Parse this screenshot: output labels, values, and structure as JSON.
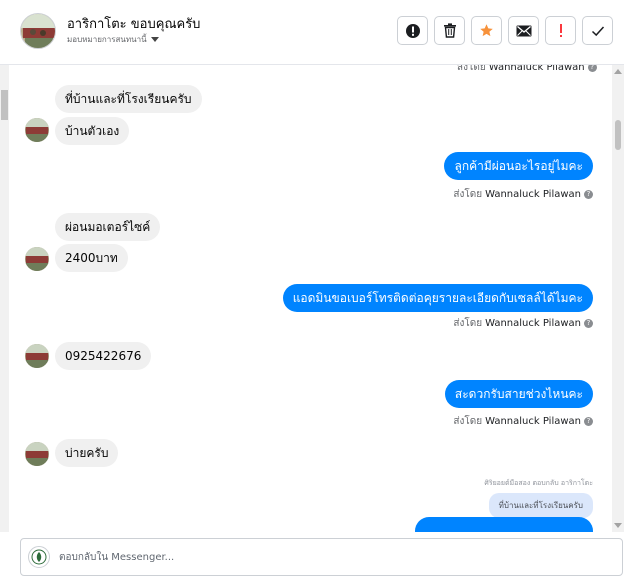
{
  "header": {
    "title": "อาริกาโตะ ขอบคุณครับ",
    "subtitle": "มอบหมายการสนทนานี้",
    "actions": [
      {
        "name": "alert-circle",
        "icon": "alert-circle-icon",
        "color": "#1c1e21"
      },
      {
        "name": "delete",
        "icon": "trash-icon",
        "color": "#1c1e21"
      },
      {
        "name": "star",
        "icon": "star-icon",
        "color": "#f7923b"
      },
      {
        "name": "mail",
        "icon": "envelope-icon",
        "color": "#1c1e21"
      },
      {
        "name": "spam",
        "icon": "exclamation-icon",
        "color": "#fa383e"
      },
      {
        "name": "done",
        "icon": "checkmark-icon",
        "color": "#1c1e21"
      }
    ]
  },
  "chat": {
    "top_sent_by": {
      "prefix": "ส่งโดย",
      "name": "Wannaluck Pilawan"
    },
    "messages": [
      {
        "dir": "in",
        "text": "ที่บ้านและที่โรงเรียนครับ"
      },
      {
        "dir": "in",
        "text": "บ้านตัวเอง"
      },
      {
        "dir": "out",
        "text": "ลูกค้ามีผ่อนอะไรอยู่ไมคะ",
        "sent_prefix": "ส่งโดย",
        "sent_name": "Wannaluck Pilawan"
      },
      {
        "dir": "in",
        "text": "ผ่อนมอเตอร์ไซค์"
      },
      {
        "dir": "in",
        "text": "2400บาท"
      },
      {
        "dir": "out",
        "text": "แอดมินขอเบอร์โทรติดต่อคุยรายละเอียดกับเซลล์ได้ไมคะ",
        "sent_prefix": "ส่งโดย",
        "sent_name": "Wannaluck Pilawan"
      },
      {
        "dir": "in",
        "text": "0925422676"
      },
      {
        "dir": "out",
        "text": "สะดวกรับสายช่วงไหนคะ",
        "sent_prefix": "ส่งโดย",
        "sent_name": "Wannaluck Pilawan"
      },
      {
        "dir": "in",
        "text": "บ่ายครับ"
      }
    ],
    "reply_note": "ศิริยอยต์มือสอง ตอบกลับ อาริกาโตะ",
    "quote_text": "ที่บ้านและที่โรงเรียนครับ",
    "help_glyph": "?"
  },
  "composer": {
    "placeholder": "ตอบกลับใน Messenger..."
  },
  "colors": {
    "accent": "#0084ff",
    "incoming_bg": "#f0f0f0",
    "quote_bg": "#dbe7fb"
  }
}
